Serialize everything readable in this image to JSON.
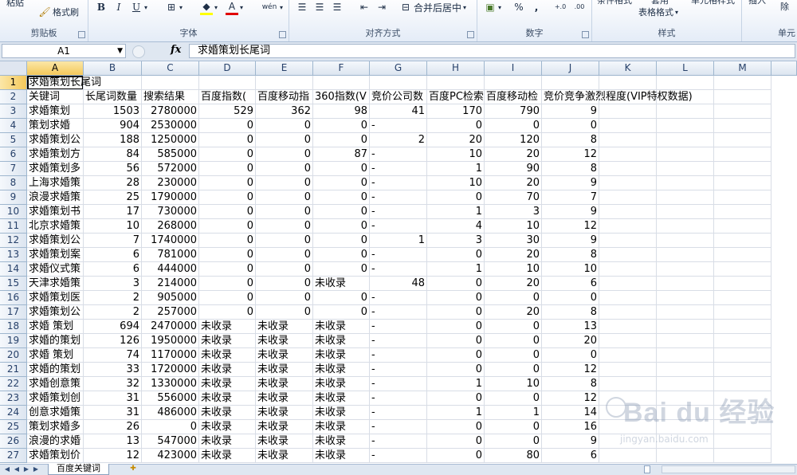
{
  "ribbon": {
    "groups": [
      {
        "label": "剪贴板"
      },
      {
        "label": "字体"
      },
      {
        "label": "对齐方式"
      },
      {
        "label": "数字"
      },
      {
        "label": "样式"
      },
      {
        "label": "单元"
      }
    ],
    "paste_label": "粘贴",
    "format_painter_label": "格式刷",
    "bold": "B",
    "italic": "I",
    "underline": "U",
    "wen": "wén",
    "merge_label": "合并后居中",
    "percent": "%",
    "comma": ",",
    "inc_decimal": "+.0",
    "dec_decimal": ".00",
    "cond_format_label": "条件格式",
    "table_format_label": "表格格式",
    "cell_style_label": "单元格样式",
    "table_label": "套用",
    "insert_label": "插入",
    "delete_label": "删除"
  },
  "formula_bar": {
    "name_box": "A1",
    "fx": "fx",
    "formula": "求婚策划长尾词"
  },
  "columns": [
    "A",
    "B",
    "C",
    "D",
    "E",
    "F",
    "G",
    "H",
    "I",
    "J",
    "K",
    "L",
    "M"
  ],
  "rows": [
    [
      "求婚策划长尾词",
      "",
      "",
      "",
      "",
      "",
      "",
      "",
      "",
      "",
      ""
    ],
    [
      "关键词",
      "长尾词数量",
      "搜索结果",
      "百度指数(",
      "百度移动指",
      "360指数(V",
      "竞价公司数",
      "百度PC检索",
      "百度移动检",
      "竞价竞争激烈程度(VIP特权数据)",
      ""
    ],
    [
      "求婚策划",
      "1503",
      "2780000",
      "529",
      "362",
      "98",
      "41",
      "170",
      "790",
      "9",
      ""
    ],
    [
      "策划求婚",
      "904",
      "2530000",
      "0",
      "0",
      "0",
      "-",
      "0",
      "0",
      "0",
      ""
    ],
    [
      "求婚策划公",
      "188",
      "1250000",
      "0",
      "0",
      "0",
      "2",
      "20",
      "120",
      "8",
      ""
    ],
    [
      "求婚策划方",
      "84",
      "585000",
      "0",
      "0",
      "87",
      "-",
      "10",
      "20",
      "12",
      ""
    ],
    [
      "求婚策划多",
      "56",
      "572000",
      "0",
      "0",
      "0",
      "-",
      "1",
      "90",
      "8",
      ""
    ],
    [
      "上海求婚策",
      "28",
      "230000",
      "0",
      "0",
      "0",
      "-",
      "10",
      "20",
      "9",
      ""
    ],
    [
      "浪漫求婚策",
      "25",
      "1790000",
      "0",
      "0",
      "0",
      "-",
      "0",
      "70",
      "7",
      ""
    ],
    [
      "求婚策划书",
      "17",
      "730000",
      "0",
      "0",
      "0",
      "-",
      "1",
      "3",
      "9",
      ""
    ],
    [
      "北京求婚策",
      "10",
      "268000",
      "0",
      "0",
      "0",
      "-",
      "4",
      "10",
      "12",
      ""
    ],
    [
      "求婚策划公",
      "7",
      "1740000",
      "0",
      "0",
      "0",
      "1",
      "3",
      "30",
      "9",
      ""
    ],
    [
      "求婚策划案",
      "6",
      "781000",
      "0",
      "0",
      "0",
      "-",
      "0",
      "20",
      "8",
      ""
    ],
    [
      "求婚仪式策",
      "6",
      "444000",
      "0",
      "0",
      "0",
      "-",
      "1",
      "10",
      "10",
      ""
    ],
    [
      "天津求婚策",
      "3",
      "214000",
      "0",
      "0",
      "未收录",
      "48",
      "0",
      "20",
      "6",
      ""
    ],
    [
      "求婚策划医",
      "2",
      "905000",
      "0",
      "0",
      "0",
      "-",
      "0",
      "0",
      "0",
      ""
    ],
    [
      "求婚策划公",
      "2",
      "257000",
      "0",
      "0",
      "0",
      "-",
      "0",
      "20",
      "8",
      ""
    ],
    [
      "求婚 策划",
      "694",
      "2470000",
      "未收录",
      "未收录",
      "未收录",
      "-",
      "0",
      "0",
      "13",
      ""
    ],
    [
      "求婚的策划",
      "126",
      "1950000",
      "未收录",
      "未收录",
      "未收录",
      "-",
      "0",
      "0",
      "20",
      ""
    ],
    [
      "求婚 策划",
      "74",
      "1170000",
      "未收录",
      "未收录",
      "未收录",
      "-",
      "0",
      "0",
      "0",
      ""
    ],
    [
      "求婚的策划",
      "33",
      "1720000",
      "未收录",
      "未收录",
      "未收录",
      "-",
      "0",
      "0",
      "12",
      ""
    ],
    [
      "求婚创意策",
      "32",
      "1330000",
      "未收录",
      "未收录",
      "未收录",
      "-",
      "1",
      "10",
      "8",
      ""
    ],
    [
      "求婚策划创",
      "31",
      "556000",
      "未收录",
      "未收录",
      "未收录",
      "-",
      "0",
      "0",
      "12",
      ""
    ],
    [
      "创意求婚策",
      "31",
      "486000",
      "未收录",
      "未收录",
      "未收录",
      "-",
      "1",
      "1",
      "14",
      ""
    ],
    [
      "策划求婚多",
      "26",
      "0",
      "未收录",
      "未收录",
      "未收录",
      "-",
      "0",
      "0",
      "16",
      ""
    ],
    [
      "浪漫的求婚",
      "13",
      "547000",
      "未收录",
      "未收录",
      "未收录",
      "-",
      "0",
      "0",
      "9",
      ""
    ],
    [
      "求婚策划价",
      "12",
      "423000",
      "未收录",
      "未收录",
      "未收录",
      "-",
      "0",
      "80",
      "6",
      ""
    ]
  ],
  "sheet_tab": "百度关键词",
  "watermark": {
    "text": "Bai du 经验",
    "sub": "jingyan.baidu.com"
  }
}
